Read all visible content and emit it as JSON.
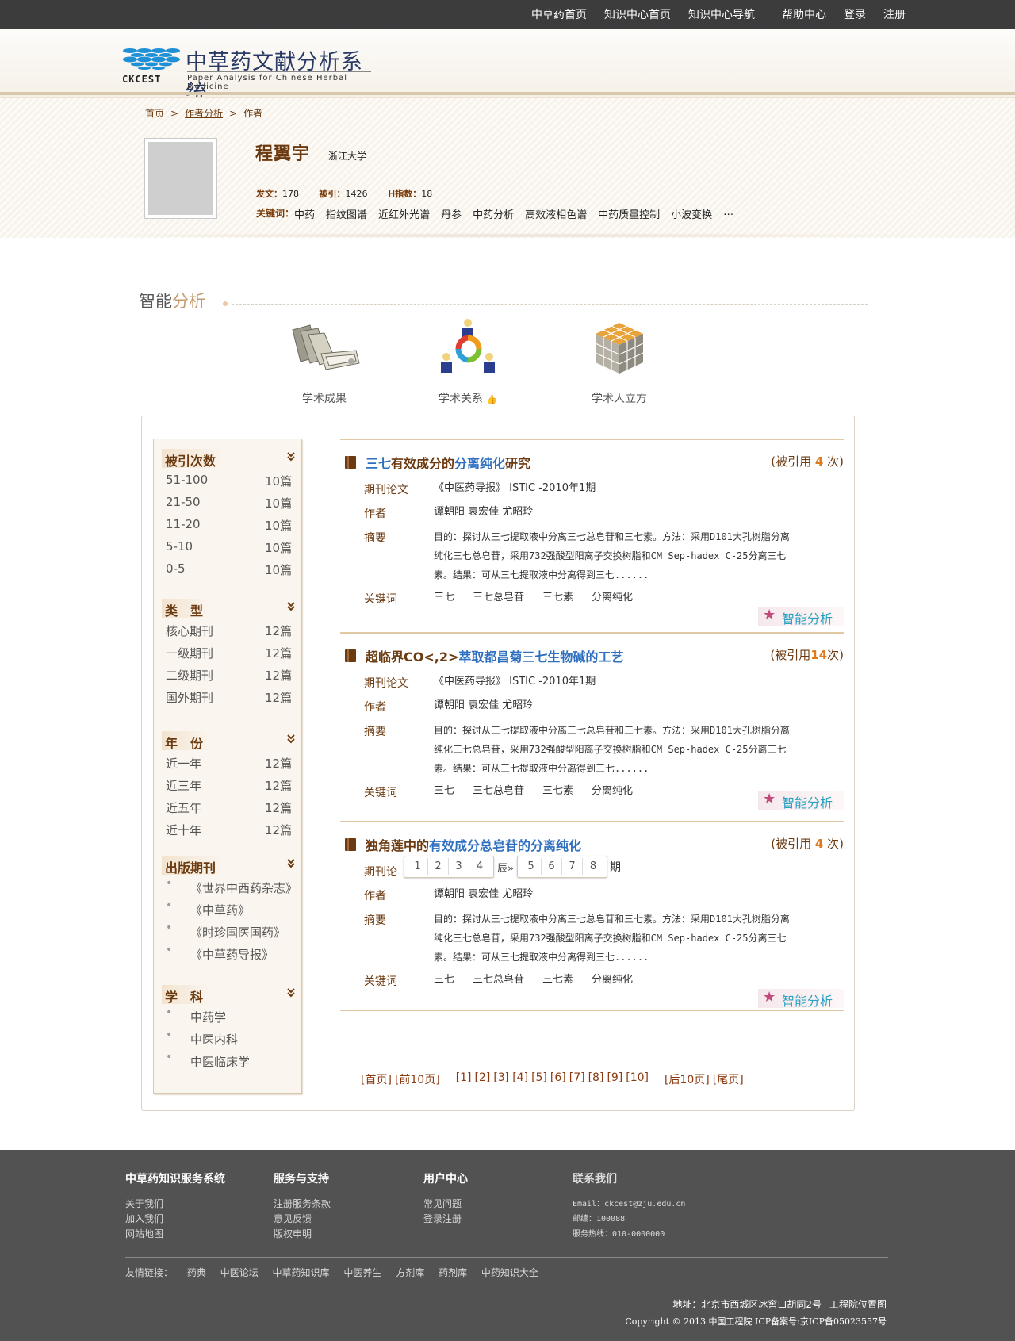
{
  "topnav": [
    "中草药首页",
    "知识中心首页",
    "知识中心导航",
    "帮助中心",
    "登录",
    "注册"
  ],
  "logo": {
    "brand": "CKCEST",
    "title": "中草药文献分析系统",
    "subtitle": "Paper Analysis for Chinese Herbal Medicine"
  },
  "breadcrumb": [
    "首页",
    "作者分析",
    "作者"
  ],
  "profile": {
    "name": "程翼宇",
    "org": "浙江大学",
    "stats": [
      {
        "label": "发文：",
        "value": "178"
      },
      {
        "label": "被引：",
        "value": "1426"
      },
      {
        "label": "H指数：",
        "value": "18"
      }
    ],
    "keywords_label": "关键词：",
    "keywords": [
      "中药",
      "指纹图谱",
      "近红外光谱",
      "丹参",
      "中药分析",
      "高效液相色谱",
      "中药质量控制",
      "小波变换",
      "…"
    ]
  },
  "section": {
    "title_main": "智能",
    "title_accent": "分析"
  },
  "features": [
    {
      "label": "学术成果"
    },
    {
      "label": "学术关系"
    },
    {
      "label": "学术人立方"
    }
  ],
  "facets": {
    "citation": {
      "title": "被引次数",
      "rows": [
        {
          "name": "51-100",
          "count": "10篇"
        },
        {
          "name": "21-50",
          "count": "10篇"
        },
        {
          "name": "11-20",
          "count": "10篇"
        },
        {
          "name": "5-10",
          "count": "10篇"
        },
        {
          "name": "0-5",
          "count": "10篇"
        }
      ]
    },
    "type": {
      "title": "类　型",
      "rows": [
        {
          "name": "核心期刊",
          "count": "12篇"
        },
        {
          "name": "一级期刊",
          "count": "12篇"
        },
        {
          "name": "二级期刊",
          "count": "12篇"
        },
        {
          "name": "国外期刊",
          "count": "12篇"
        }
      ]
    },
    "year": {
      "title": "年　份",
      "rows": [
        {
          "name": "近一年",
          "count": "12篇"
        },
        {
          "name": "近三年",
          "count": "12篇"
        },
        {
          "name": "近五年",
          "count": "12篇"
        },
        {
          "name": "近十年",
          "count": "12篇"
        }
      ]
    },
    "journal": {
      "title": "出版期刊",
      "rows": [
        "《世界中西药杂志》",
        "《中草药》",
        "《时珍国医国药》",
        "《中草药导报》"
      ]
    },
    "subject": {
      "title": "学　科",
      "rows": [
        "中药学",
        "中医内科",
        "中医临床学"
      ]
    }
  },
  "papers": [
    {
      "title_parts": [
        {
          "t": "三七",
          "hl": true
        },
        {
          "t": "有效成分的",
          "hl": false
        },
        {
          "t": "分离纯化",
          "hl": true
        },
        {
          "t": "研究",
          "hl": false
        }
      ],
      "cite_pre": "(被引用",
      "cite_num": "4",
      "cite_post": "次)",
      "type": "期刊论文",
      "source": "《中医药导报》 ISTIC -2010年1期",
      "author_label": "作者",
      "authors": "谭朝阳 袁宏佳 尤昭玲",
      "abstract_label": "摘要",
      "abstract": "目的：探讨从三七提取液中分离三七总皂苷和三七素。方法：采用D101大孔树脂分离纯化三七总皂苷，采用732强酸型阳离子交换树脂和CM Sep-hadex C-25分离三七素。结果：可从三七提取液中分离得到三七......",
      "kw_label": "关键词",
      "keywords": [
        "三七",
        "三七总皂苷",
        "三七素",
        "分离纯化"
      ],
      "smart": "智能分析"
    },
    {
      "title_parts": [
        {
          "t": "超临界CO<,2>",
          "hl": false
        },
        {
          "t": "萃取都昌菊三七生物碱的工艺",
          "hl": true
        }
      ],
      "cite_pre": "(被引用",
      "cite_num": "14",
      "cite_post": "次)",
      "type": "期刊论文",
      "source": "《中医药导报》 ISTIC -2010年1期",
      "author_label": "作者",
      "authors": "谭朝阳 袁宏佳 尤昭玲",
      "abstract_label": "摘要",
      "abstract": "目的：探讨从三七提取液中分离三七总皂苷和三七素。方法：采用D101大孔树脂分离纯化三七总皂苷，采用732强酸型阳离子交换树脂和CM Sep-hadex C-25分离三七素。结果：可从三七提取液中分离得到三七......",
      "kw_label": "关键词",
      "keywords": [
        "三七",
        "三七总皂苷",
        "三七素",
        "分离纯化"
      ],
      "smart": "智能分析"
    },
    {
      "title_parts": [
        {
          "t": "独角莲中的",
          "hl": false
        },
        {
          "t": "有效成分总皂苷的分离纯化",
          "hl": true
        }
      ],
      "cite_pre": "(被引用",
      "cite_num": "4",
      "cite_post": "次)",
      "type": "期刊论",
      "type_tail": "期",
      "page_popup": {
        "group1": [
          "1",
          "2",
          "3",
          "4"
        ],
        "middle": "辰»",
        "group2": [
          "5",
          "6",
          "7",
          "8"
        ]
      },
      "author_label": "作者",
      "authors": "谭朝阳 袁宏佳 尤昭玲",
      "abstract_label": "摘要",
      "abstract": "目的：探讨从三七提取液中分离三七总皂苷和三七素。方法：采用D101大孔树脂分离纯化三七总皂苷，采用732强酸型阳离子交换树脂和CM Sep-hadex C-25分离三七素。结果：可从三七提取液中分离得到三七......",
      "kw_label": "关键词",
      "keywords": [
        "三七",
        "三七总皂苷",
        "三七素",
        "分离纯化"
      ],
      "smart": "智能分析"
    }
  ],
  "pager": {
    "first": "[首页]",
    "prev": "[前10页]",
    "pages": [
      "[1]",
      "[2]",
      "[3]",
      "[4]",
      "[5]",
      "[6]",
      "[7]",
      "[8]",
      "[9]",
      "[10]"
    ],
    "next": "[后10页]",
    "last": "[尾页]"
  },
  "footer": {
    "cols": [
      {
        "title": "中草药知识服务系统",
        "links": [
          "关于我们",
          "加入我们",
          "网站地图"
        ]
      },
      {
        "title": "服务与支持",
        "links": [
          "注册服务条款",
          "意见反馈",
          "版权申明"
        ]
      },
      {
        "title": "用户中心",
        "links": [
          "常见问题",
          "登录注册"
        ]
      }
    ],
    "contact": {
      "title": "联系我们",
      "lines": [
        "Email：ckcest@zju.edu.cn",
        "邮编：100088",
        "服务热线：010-0000000"
      ]
    },
    "friends_label": "友情链接：",
    "friends": [
      "药典",
      "中医论坛",
      "中草药知识库",
      "中医养生",
      "方剂库",
      "药剂库",
      "中药知识大全"
    ],
    "address": "地址：北京市西城区冰窖口胡同2号",
    "map_link": "工程院位置图",
    "copyright": "Copyright © 2013 中国工程院 ICP备案号:京ICP备05023557号"
  }
}
